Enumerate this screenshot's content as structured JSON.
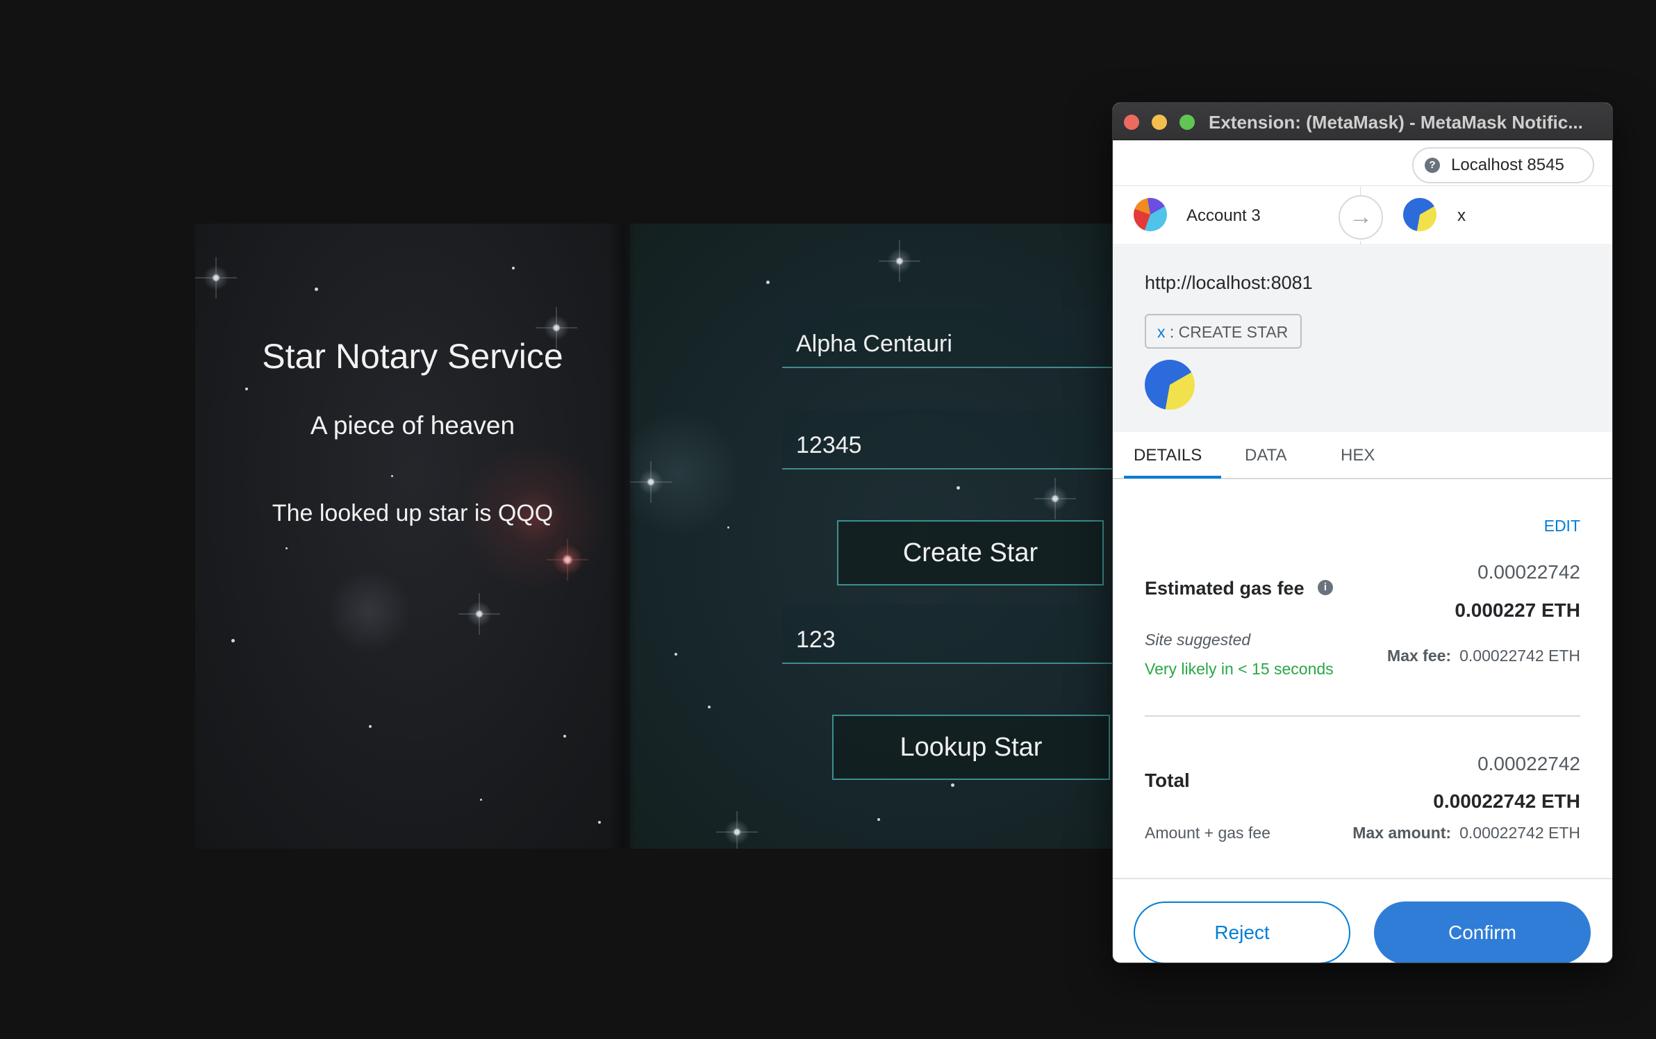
{
  "app": {
    "title": "Star Notary Service",
    "subtitle": "A piece of heaven",
    "result": "The looked up star is QQQ",
    "star_name_value": "Alpha Centauri",
    "star_id_value": "12345",
    "create_button": "Create Star",
    "lookup_id_value": "123",
    "lookup_button": "Lookup Star"
  },
  "metamask": {
    "window_title": "Extension: (MetaMask) - MetaMask Notific...",
    "network": "Localhost 8545",
    "network_icon": "?",
    "from_account": "Account 3",
    "to_account": "x",
    "origin": "http://localhost:8081",
    "method_prefix": "x",
    "method_name": ": CREATE STAR",
    "tabs": [
      "DETAILS",
      "DATA",
      "HEX"
    ],
    "edit_label": "EDIT",
    "gas": {
      "label": "Estimated gas fee",
      "info_icon": "i",
      "amount": "0.00022742",
      "amount_eth": "0.000227 ETH",
      "site_suggested": "Site suggested",
      "likelihood": "Very likely in < 15 seconds",
      "max_fee_label": "Max fee:",
      "max_fee_value": "0.00022742  ETH"
    },
    "total": {
      "label": "Total",
      "amount": "0.00022742",
      "amount_eth": "0.00022742 ETH",
      "sub_label": "Amount + gas fee",
      "max_amount_label": "Max amount:",
      "max_amount_value": "0.00022742  ETH"
    },
    "reject_label": "Reject",
    "confirm_label": "Confirm"
  }
}
